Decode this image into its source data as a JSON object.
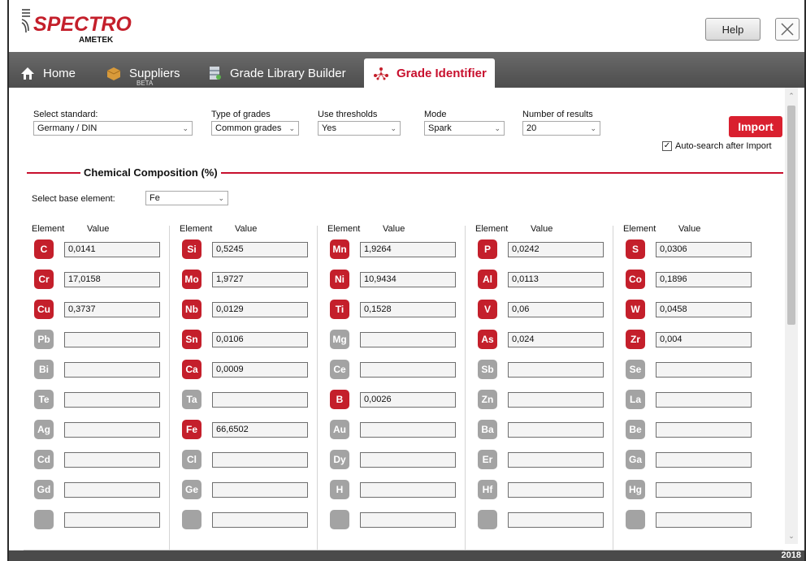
{
  "header": {
    "logo_text": "SPECTRO",
    "logo_subtext": "AMETEK",
    "help_label": "Help"
  },
  "tabs": [
    {
      "label": "Home",
      "icon": "home-icon"
    },
    {
      "label": "Suppliers",
      "icon": "box-icon",
      "sub": "BETA"
    },
    {
      "label": "Grade Library Builder",
      "icon": "library-icon"
    },
    {
      "label": "Grade Identifier",
      "icon": "molecule-icon",
      "active": true
    }
  ],
  "controls": {
    "standard": {
      "label": "Select standard:",
      "value": "Germany / DIN"
    },
    "grades": {
      "label": "Type of grades",
      "value": "Common grades"
    },
    "thresholds": {
      "label": "Use thresholds",
      "value": "Yes"
    },
    "mode": {
      "label": "Mode",
      "value": "Spark"
    },
    "results": {
      "label": "Number of results",
      "value": "20"
    },
    "import_label": "Import",
    "auto_search_label": "Auto-search after Import",
    "auto_search_checked": true
  },
  "composition": {
    "title": "Chemical Composition (%)",
    "base_label": "Select base element:",
    "base_value": "Fe",
    "col_element": "Element",
    "col_value": "Value"
  },
  "colors": {
    "accent": "#c41f2b",
    "inactive": "#a3a3a3"
  },
  "footer": {
    "year": "2018"
  }
}
